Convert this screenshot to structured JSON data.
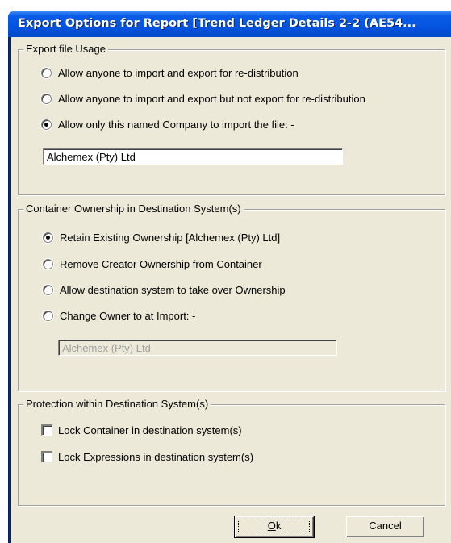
{
  "window": {
    "title": "Export Options for Report [Trend Ledger Details 2-2 (AE54..."
  },
  "export_usage": {
    "legend": "Export file Usage",
    "options": [
      {
        "label": "Allow anyone to import and export for re-distribution",
        "selected": false
      },
      {
        "label": "Allow anyone to import and export but not export for re-distribution",
        "selected": false
      },
      {
        "label": "Allow only this named Company to import the file: -",
        "selected": true
      }
    ],
    "company_value": "Alchemex (Pty) Ltd"
  },
  "ownership": {
    "legend": "Container Ownership in Destination System(s)",
    "options": [
      {
        "label": "Retain Existing Ownership [Alchemex (Pty) Ltd]",
        "selected": true
      },
      {
        "label": "Remove Creator Ownership from Container",
        "selected": false
      },
      {
        "label": "Allow destination system to take over Ownership",
        "selected": false
      },
      {
        "label": "Change Owner to at Import: -",
        "selected": false
      }
    ],
    "owner_value": "Alchemex (Pty) Ltd"
  },
  "protection": {
    "legend": "Protection within Destination System(s)",
    "checks": [
      {
        "label": "Lock Container in destination system(s)",
        "checked": false
      },
      {
        "label": "Lock Expressions in destination system(s)",
        "checked": false
      }
    ]
  },
  "buttons": {
    "ok_mnemonic": "O",
    "ok_rest": "k",
    "cancel": "Cancel"
  }
}
